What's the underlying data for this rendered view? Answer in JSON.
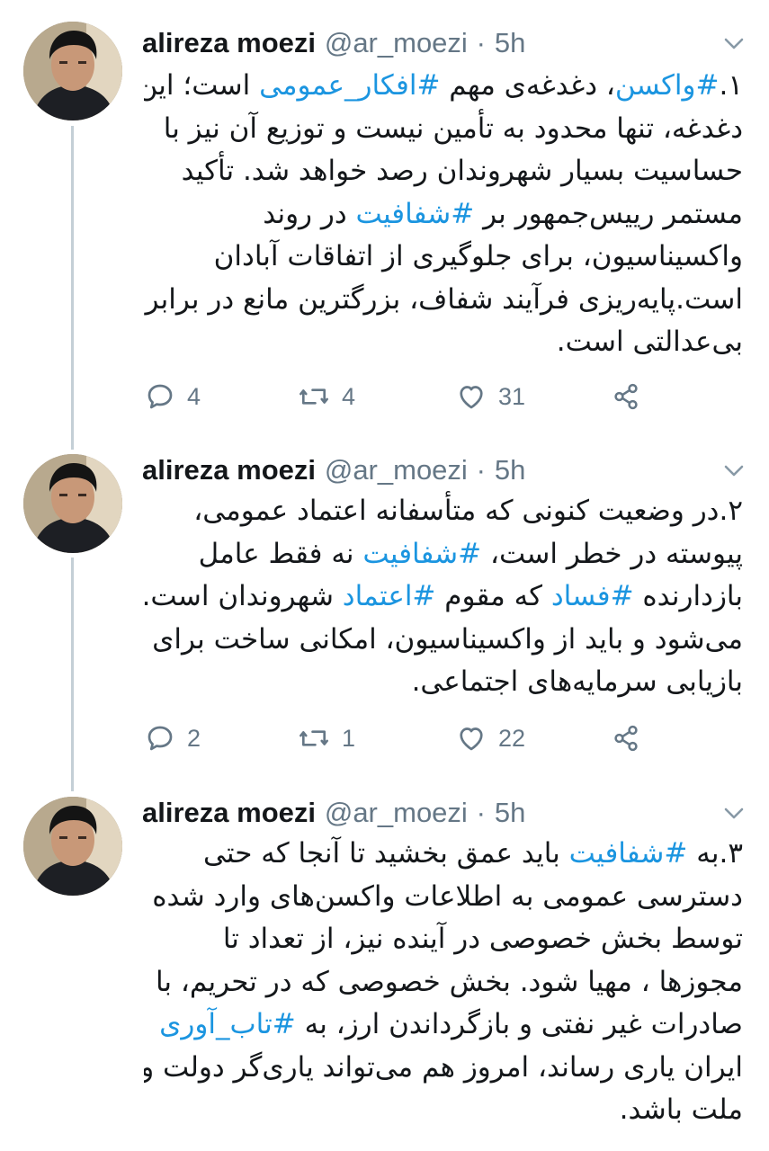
{
  "tweets": [
    {
      "author": {
        "name": "alireza moezi",
        "handle": "@ar_moezi",
        "separator": "·",
        "time": "5h"
      },
      "lines": [
        [
          {
            "t": "۱."
          },
          {
            "t": "#واکسن",
            "link": true
          },
          {
            "t": "، دغدغه‌ی مهم "
          },
          {
            "t": "#افکار_عمومی",
            "link": true
          },
          {
            "t": " است؛ این"
          }
        ],
        [
          {
            "t": "دغدغه، تنها محدود به تأمین نیست و توزیع آن نیز با"
          }
        ],
        [
          {
            "t": "حساسیت بسیار شهروندان رصد خواهد شد. تأکید"
          }
        ],
        [
          {
            "t": "مستمر رییس‌جمهور بر "
          },
          {
            "t": "#شفافیت",
            "link": true
          },
          {
            "t": " در روند"
          }
        ],
        [
          {
            "t": "واکسیناسیون، برای جلوگیری از اتفاقات آبادان"
          }
        ],
        [
          {
            "t": "است.پایه‌ریزی فرآیند شفاف، بزرگترین مانع در برابر"
          }
        ],
        [
          {
            "t": "بی‌عدالتی است."
          }
        ]
      ],
      "stats": {
        "replies": "4",
        "retweets": "4",
        "likes": "31"
      }
    },
    {
      "author": {
        "name": "alireza moezi",
        "handle": "@ar_moezi",
        "separator": "·",
        "time": "5h"
      },
      "lines": [
        [
          {
            "t": "۲.در وضعیت کنونی که متأسفانه اعتماد عمومی،"
          }
        ],
        [
          {
            "t": "پیوسته در خطر است، "
          },
          {
            "t": "#شفافیت",
            "link": true
          },
          {
            "t": " نه فقط عامل"
          }
        ],
        [
          {
            "t": "بازدارنده "
          },
          {
            "t": "#فساد",
            "link": true
          },
          {
            "t": " که مقوم "
          },
          {
            "t": "#اعتماد",
            "link": true
          },
          {
            "t": " شهروندان است."
          }
        ],
        [
          {
            "t": "می‌شود و باید از واکسیناسیون، امکانی ساخت برای"
          }
        ],
        [
          {
            "t": "بازیابی سرمایه‌های اجتماعی."
          }
        ]
      ],
      "stats": {
        "replies": "2",
        "retweets": "1",
        "likes": "22"
      }
    },
    {
      "author": {
        "name": "alireza moezi",
        "handle": "@ar_moezi",
        "separator": "·",
        "time": "5h"
      },
      "lines": [
        [
          {
            "t": "۳.به "
          },
          {
            "t": "#شفافیت",
            "link": true
          },
          {
            "t": " باید عمق بخشید تا آنجا که حتی"
          }
        ],
        [
          {
            "t": "دسترسی عمومی به اطلاعات واکسن‌های وارد شده"
          }
        ],
        [
          {
            "t": "توسط بخش خصوصی در آینده نیز، از تعداد تا"
          }
        ],
        [
          {
            "t": "مجوزها ، مهیا شود. بخش خصوصی که در تحریم، با"
          }
        ],
        [
          {
            "t": "صادرات غیر نفتی و بازگرداندن ارز، به "
          },
          {
            "t": "#تاب_آوری",
            "link": true
          }
        ],
        [
          {
            "t": "ایران یاری رساند، امروز هم می‌تواند یاری‌گر دولت و"
          }
        ],
        [
          {
            "t": "ملت باشد."
          }
        ]
      ],
      "stats": null
    }
  ],
  "icons": {
    "reply": "reply-icon",
    "retweet": "retweet-icon",
    "like": "heart-icon",
    "share": "share-icon",
    "caret": "chevron-down-icon",
    "avatar": "avatar"
  },
  "colors": {
    "link": "#1b95e0",
    "muted": "#657786",
    "text": "#14171a",
    "thread": "#c4cfd6"
  }
}
